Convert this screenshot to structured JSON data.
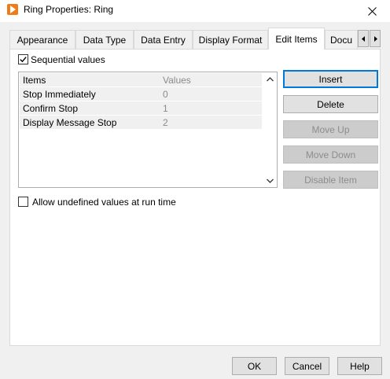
{
  "window": {
    "title": "Ring Properties: Ring",
    "app_icon": "labview-arrow-icon",
    "accent_color": "#f07c17"
  },
  "tabs": [
    {
      "label": "Appearance"
    },
    {
      "label": "Data Type"
    },
    {
      "label": "Data Entry"
    },
    {
      "label": "Display Format"
    },
    {
      "label": "Edit Items",
      "active": true
    },
    {
      "label": "Docu"
    }
  ],
  "sequential_values": {
    "label": "Sequential values",
    "checked": true
  },
  "list": {
    "header_items": "Items",
    "header_values": "Values",
    "rows": [
      {
        "item": "Stop Immediately",
        "value": "0"
      },
      {
        "item": "Confirm Stop",
        "value": "1"
      },
      {
        "item": "Display Message Stop",
        "value": "2"
      }
    ]
  },
  "side_buttons": {
    "insert": "Insert",
    "delete": "Delete",
    "move_up": "Move Up",
    "move_down": "Move Down",
    "disable_item": "Disable Item"
  },
  "allow_undefined": {
    "label": "Allow undefined values at run time",
    "checked": false
  },
  "footer": {
    "ok": "OK",
    "cancel": "Cancel",
    "help": "Help"
  }
}
